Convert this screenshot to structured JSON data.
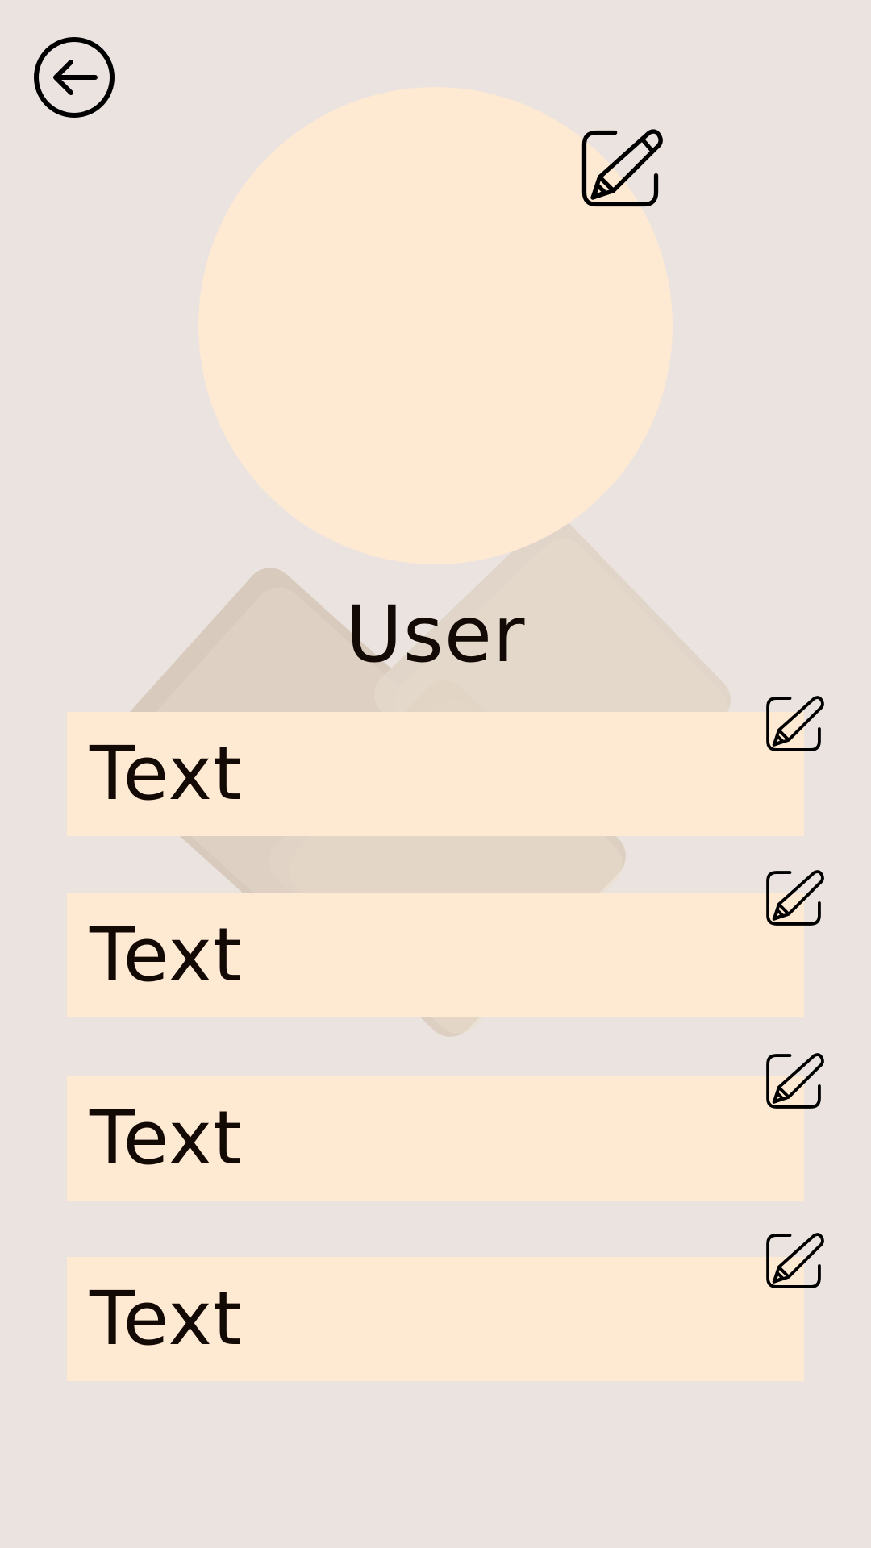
{
  "profile": {
    "name": "User"
  },
  "fields": [
    {
      "value": "Text"
    },
    {
      "value": "Text"
    },
    {
      "value": "Text"
    },
    {
      "value": "Text"
    }
  ],
  "icons": {
    "back": "arrow-left-circle-icon",
    "edit": "pencil-square-icon"
  },
  "colors": {
    "background": "#ebe3df",
    "surface": "#fee9d3",
    "text": "#130a06",
    "decoration": "#d8ccbd"
  }
}
